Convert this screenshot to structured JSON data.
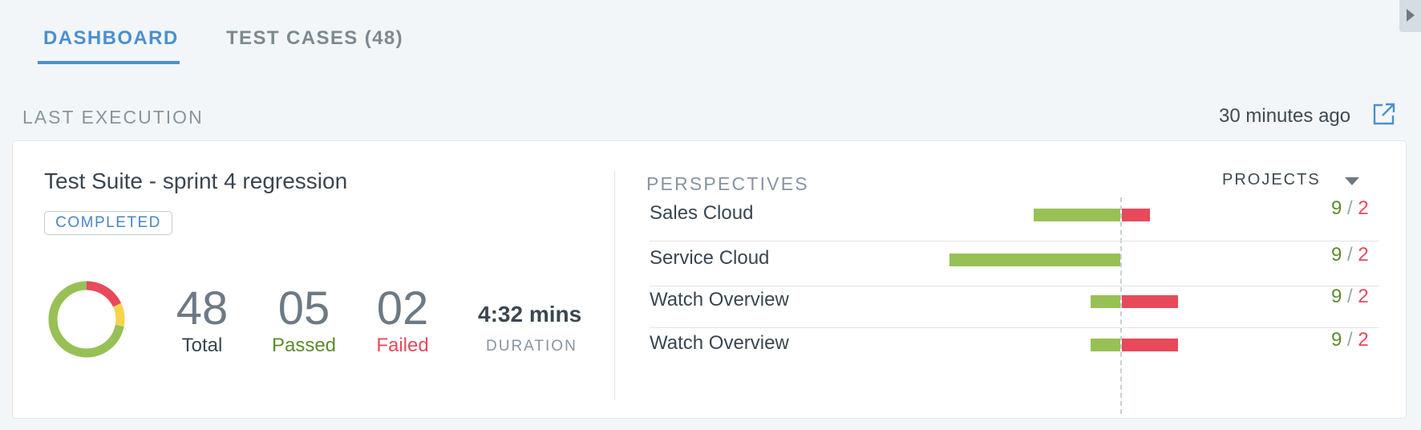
{
  "tabs": [
    {
      "label": "DASHBOARD",
      "active": true
    },
    {
      "label": "TEST CASES (48)",
      "active": false
    }
  ],
  "section": {
    "title": "LAST EXECUTION",
    "timestamp": "30 minutes ago"
  },
  "suite": {
    "title": "Test Suite - sprint 4 regression",
    "status": "COMPLETED",
    "stats": {
      "total": {
        "value": "48",
        "label": "Total"
      },
      "passed": {
        "value": "05",
        "label": "Passed"
      },
      "failed": {
        "value": "02",
        "label": "Failed"
      }
    },
    "duration": {
      "value": "4:32 mins",
      "label": "DURATION"
    },
    "donut": {
      "passed_fraction": 0.72,
      "failed_fraction": 0.18,
      "skipped_fraction": 0.1
    }
  },
  "perspectives": {
    "title": "PERSPECTIVES",
    "filter_label": "PROJECTS",
    "rows": [
      {
        "name": "Sales Cloud",
        "pass": 9,
        "fail": 2,
        "pass_bar": 0.49,
        "fail_bar": 0.16
      },
      {
        "name": "Service Cloud",
        "pass": 9,
        "fail": 2,
        "pass_bar": 0.97,
        "fail_bar": 0.0
      },
      {
        "name": "Watch Overview",
        "pass": 9,
        "fail": 2,
        "pass_bar": 0.17,
        "fail_bar": 0.32
      },
      {
        "name": "Watch Overview",
        "pass": 9,
        "fail": 2,
        "pass_bar": 0.17,
        "fail_bar": 0.32
      }
    ]
  },
  "colors": {
    "accent": "#4a90cf",
    "pass": "#97c155",
    "fail": "#e8495b",
    "skip": "#f5d44a"
  },
  "icons": {
    "open": "external-link-icon",
    "dropdown": "caret-down-icon",
    "collapse": "caret-right-icon"
  }
}
